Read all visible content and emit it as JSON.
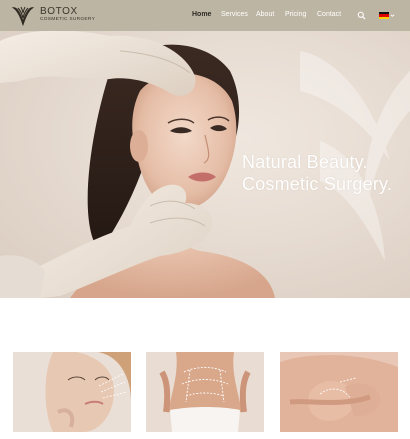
{
  "brand": {
    "name": "BOTOX",
    "tagline": "COSMETIC SURGERY"
  },
  "nav": {
    "items": [
      {
        "label": "Home",
        "active": true
      },
      {
        "label": "Services",
        "active": false
      },
      {
        "label": "About",
        "active": false
      },
      {
        "label": "Pricing",
        "active": false
      },
      {
        "label": "Contact",
        "active": false
      }
    ],
    "search_icon": "search-icon",
    "language_flag": "german-flag-icon"
  },
  "hero": {
    "title_line1": "Natural Beauty.",
    "title_line2": "Cosmetic Surgery."
  },
  "gallery": {
    "cards": [
      {
        "subject": "face-treatment-photo"
      },
      {
        "subject": "abdomen-marking-photo"
      },
      {
        "subject": "breast-marking-photo"
      }
    ]
  },
  "colors": {
    "header_bg": "#bdb5a3",
    "accent_text": "#2d2a25",
    "hero_text": "#ffffff"
  }
}
